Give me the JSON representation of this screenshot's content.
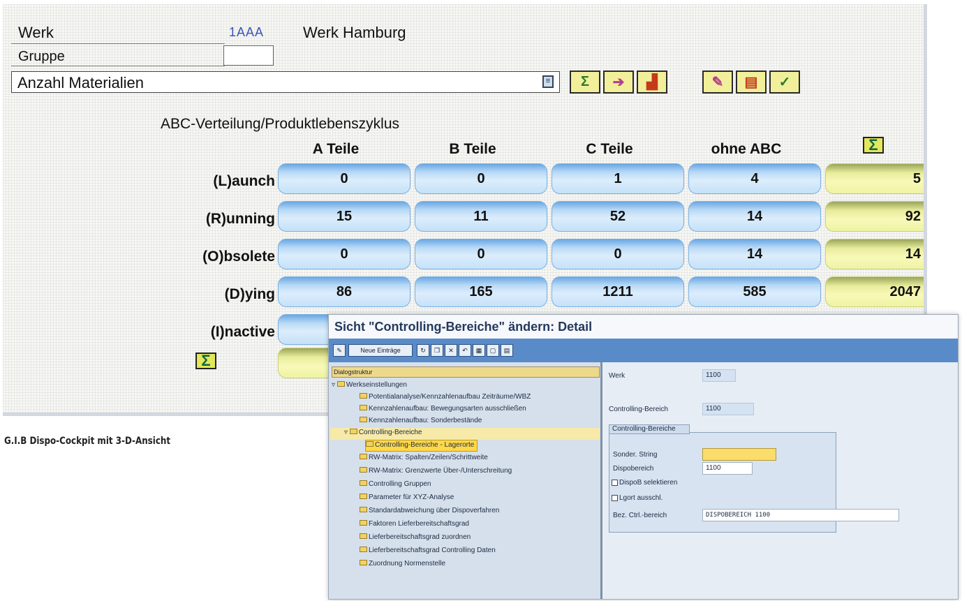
{
  "cockpit": {
    "werk_label": "Werk",
    "werk_code": "1AAA",
    "werk_name": "Werk Hamburg",
    "gruppe_label": "Gruppe",
    "gruppe_value": "",
    "selection_value": "Anzahl Materialien",
    "toolbar_icons": [
      "sum-icon",
      "forward-icon",
      "print-icon",
      "edit-icon",
      "list-icon",
      "check-icon"
    ],
    "matrix_title": "ABC-Verteilung/Produktlebenszyklus",
    "columns": [
      "A Teile",
      "B Teile",
      "C Teile",
      "ohne ABC"
    ],
    "sum_symbol": "Σ",
    "rows": [
      {
        "label": "(L)aunch",
        "values": [
          "0",
          "0",
          "1",
          "4"
        ],
        "sum": "5"
      },
      {
        "label": "(R)unning",
        "values": [
          "15",
          "11",
          "52",
          "14"
        ],
        "sum": "92"
      },
      {
        "label": "(O)bsolete",
        "values": [
          "0",
          "0",
          "0",
          "14"
        ],
        "sum": "14"
      },
      {
        "label": "(D)ying",
        "values": [
          "86",
          "165",
          "1211",
          "585"
        ],
        "sum": "2047"
      },
      {
        "label": "(I)nactive",
        "values": [
          "",
          "",
          "",
          ""
        ],
        "sum": ""
      }
    ],
    "caption": "G.I.B Dispo-Cockpit mit 3-D-Ansicht"
  },
  "dialog": {
    "title": "Sicht \"Controlling-Bereiche\" ändern: Detail",
    "toolbar": {
      "new_entries": "Neue Einträge"
    },
    "tree": {
      "header": "Dialogstruktur",
      "items": [
        {
          "label": "Werkseinstellungen",
          "level": 0,
          "open": true
        },
        {
          "label": "Potentialanalyse/Kennzahlenaufbau Zeiträume/WBZ",
          "level": 1
        },
        {
          "label": "Kennzahlenaufbau: Bewegungsarten ausschließen",
          "level": 1
        },
        {
          "label": "Kennzahlenaufbau: Sonderbestände",
          "level": 1
        },
        {
          "label": "Controlling-Bereiche",
          "level": 0,
          "open": true,
          "highlight": true
        },
        {
          "label": "Controlling-Bereiche - Lagerorte",
          "level": 2,
          "selected": true
        },
        {
          "label": "RW-Matrix: Spalten/Zeilen/Schrittweite",
          "level": 1
        },
        {
          "label": "RW-Matrix: Grenzwerte Über-/Unterschreitung",
          "level": 1
        },
        {
          "label": "Controlling Gruppen",
          "level": 1
        },
        {
          "label": "Parameter für XYZ-Analyse",
          "level": 1
        },
        {
          "label": "Standardabweichung über Dispoverfahren",
          "level": 1
        },
        {
          "label": "Faktoren Lieferbereitschaftsgrad",
          "level": 1
        },
        {
          "label": "Lieferbereitschaftsgrad zuordnen",
          "level": 1
        },
        {
          "label": "Lieferbereitschaftsgrad Controlling Daten",
          "level": 1
        },
        {
          "label": "Zuordnung Normenstelle",
          "level": 1
        }
      ]
    },
    "detail": {
      "werk_label": "Werk",
      "werk_value": "1100",
      "ctrl_label": "Controlling-Bereich",
      "ctrl_value": "1100",
      "group_title": "Controlling-Bereiche",
      "sonder_label": "Sonder. String",
      "sonder_value": "",
      "dispo_label": "Dispobereich",
      "dispo_value": "1100",
      "dispoB_check": "DispoB selektieren",
      "lgort_check": "Lgort ausschl.",
      "bez_label": "Bez. Ctrl.-bereich",
      "bez_value": "DISPOBEREICH 1100"
    }
  }
}
